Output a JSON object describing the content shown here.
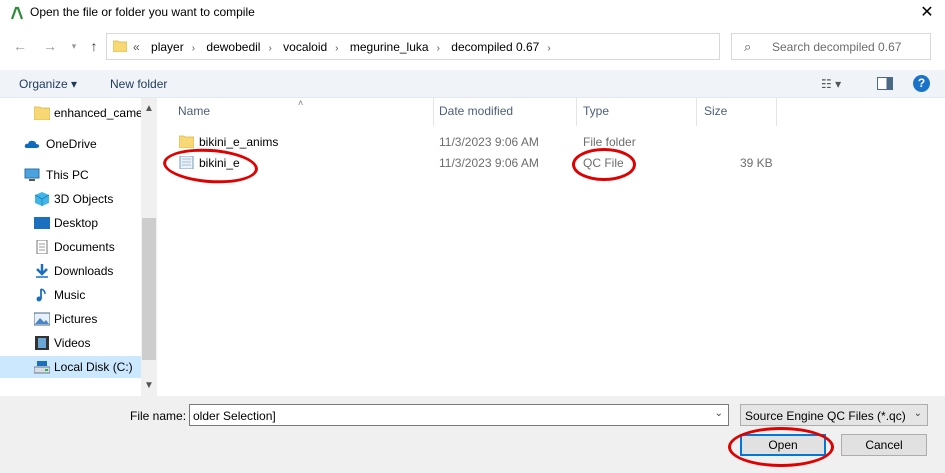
{
  "window": {
    "title": "Open the file or folder you want to compile"
  },
  "breadcrumb": {
    "overflow": "«",
    "items": [
      "player",
      "dewobedil",
      "vocaloid",
      "megurine_luka",
      "decompiled 0.67"
    ]
  },
  "search": {
    "placeholder": "Search decompiled 0.67"
  },
  "toolbar": {
    "organize": "Organize ▾",
    "new_folder": "New folder"
  },
  "sidebar": {
    "items": [
      {
        "label": "enhanced_came",
        "icon": "folder-icon"
      },
      {
        "label": "OneDrive",
        "icon": "cloud-icon"
      },
      {
        "label": "This PC",
        "icon": "computer-icon"
      },
      {
        "label": "3D Objects",
        "icon": "cube-icon"
      },
      {
        "label": "Desktop",
        "icon": "desktop-icon"
      },
      {
        "label": "Documents",
        "icon": "document-icon"
      },
      {
        "label": "Downloads",
        "icon": "download-icon"
      },
      {
        "label": "Music",
        "icon": "music-icon"
      },
      {
        "label": "Pictures",
        "icon": "pictures-icon"
      },
      {
        "label": "Videos",
        "icon": "video-icon"
      },
      {
        "label": "Local Disk (C:)",
        "icon": "drive-icon"
      }
    ]
  },
  "columns": {
    "name": "Name",
    "date": "Date modified",
    "type": "Type",
    "size": "Size"
  },
  "files": [
    {
      "name": "bikini_e_anims",
      "date": "11/3/2023 9:06 AM",
      "type": "File folder",
      "size": ""
    },
    {
      "name": "bikini_e",
      "date": "11/3/2023 9:06 AM",
      "type": "QC File",
      "size": "39 KB"
    }
  ],
  "bottom": {
    "filename_label": "File name:",
    "filename_value": "older Selection]",
    "filetype": "Source Engine QC Files (*.qc)",
    "open_label": "Open",
    "cancel_label": "Cancel"
  },
  "colors": {
    "accent": "#0078d7",
    "annotation": "#e00000",
    "selection": "#cce8ff"
  }
}
